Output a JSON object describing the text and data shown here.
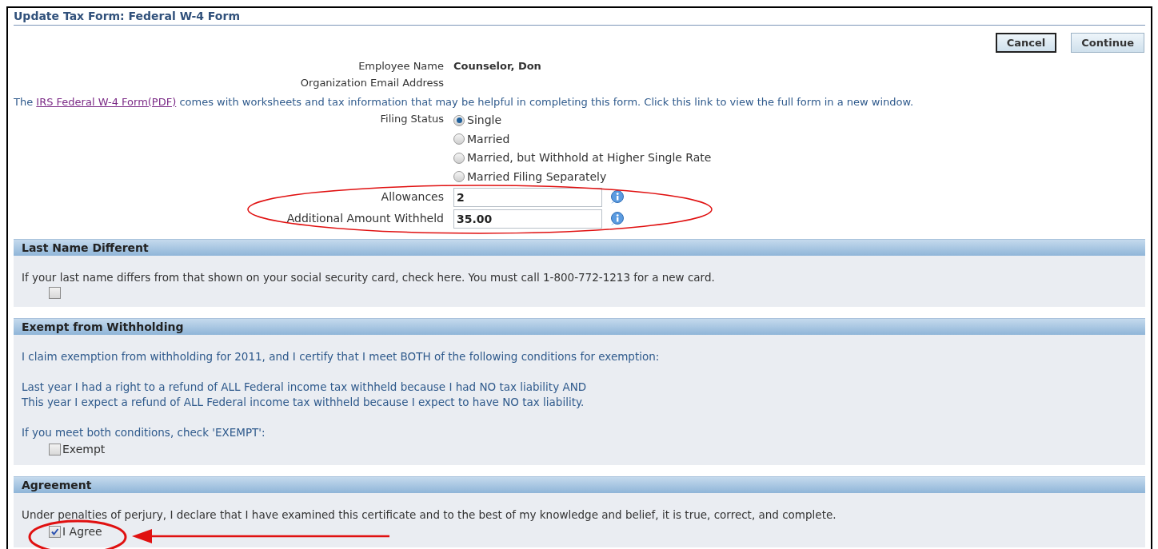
{
  "page_title": "Update Tax Form: Federal W-4 Form",
  "buttons": [
    {
      "label": "Cancel",
      "focused": true
    },
    {
      "label": "Continue",
      "focused": false
    }
  ],
  "employee": {
    "name_label": "Employee Name",
    "name_value": "Counselor, Don",
    "email_label": "Organization Email Address"
  },
  "intro": {
    "before": "The ",
    "link": "IRS Federal W-4 Form(PDF)",
    "after": " comes with worksheets and tax information that may be helpful in completing this form. Click this link to view the full form in a new window."
  },
  "filing_status": {
    "label": "Filing Status",
    "options": [
      {
        "label": "Single",
        "selected": true
      },
      {
        "label": "Married",
        "selected": false
      },
      {
        "label": "Married, but Withhold at Higher Single Rate",
        "selected": false
      },
      {
        "label": "Married Filing Separately",
        "selected": false
      }
    ]
  },
  "fields": [
    {
      "label": "Allowances",
      "value": "2"
    },
    {
      "label": "Additional Amount Withheld",
      "value": "35.00"
    }
  ],
  "sections": [
    {
      "title": "Last Name Different",
      "paragraphs": [
        "If your last name differs from that shown on your social security card, check here. You must call 1-800-772-1213 for a new card."
      ],
      "checkbox": {
        "checked": false
      }
    },
    {
      "title": "Exempt from Withholding",
      "paragraphs": [
        "I claim exemption from withholding for 2011, and I certify that I meet BOTH of the following conditions for exemption:",
        "Last year I had a right to a refund of ALL Federal income tax withheld because I had NO tax liability AND\nThis year I expect a refund of ALL Federal income tax withheld because I expect to have NO tax liability.",
        "If you meet both conditions, check 'EXEMPT':"
      ],
      "checkbox": {
        "label": "Exempt",
        "checked": false
      }
    },
    {
      "title": "Agreement",
      "paragraphs": [
        "Under penalties of perjury, I declare that I have examined this certificate and to the best of my knowledge and belief, it is true, correct, and complete."
      ],
      "checkbox": {
        "label": "I Agree",
        "checked": true
      }
    }
  ]
}
